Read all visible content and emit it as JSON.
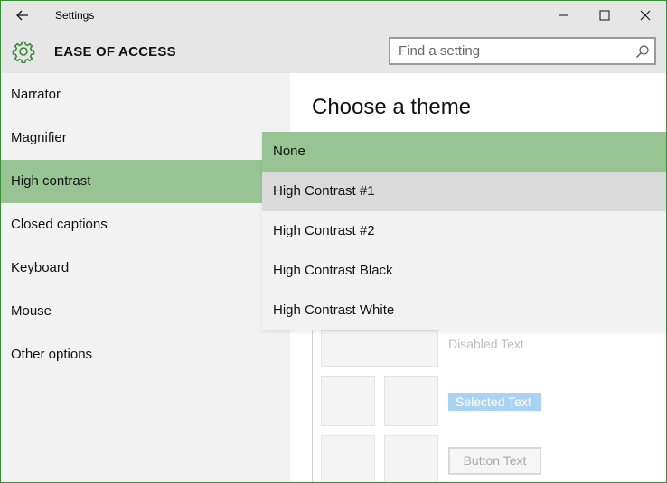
{
  "window": {
    "title": "Settings",
    "accent_color": "#98c494",
    "border_color": "#3a8a3a"
  },
  "header": {
    "section_title": "EASE OF ACCESS",
    "icon": "gear-icon",
    "search": {
      "placeholder": "Find a setting",
      "value": ""
    }
  },
  "sidebar": {
    "items": [
      {
        "label": "Narrator",
        "selected": false
      },
      {
        "label": "Magnifier",
        "selected": false
      },
      {
        "label": "High contrast",
        "selected": true
      },
      {
        "label": "Closed captions",
        "selected": false
      },
      {
        "label": "Keyboard",
        "selected": false
      },
      {
        "label": "Mouse",
        "selected": false
      },
      {
        "label": "Other options",
        "selected": false
      }
    ]
  },
  "main": {
    "heading": "Choose a theme",
    "theme_dropdown": {
      "options": [
        {
          "label": "None",
          "state": "selected"
        },
        {
          "label": "High Contrast #1",
          "state": "hover"
        },
        {
          "label": "High Contrast #2",
          "state": "normal"
        },
        {
          "label": "High Contrast Black",
          "state": "normal"
        },
        {
          "label": "High Contrast White",
          "state": "normal"
        }
      ]
    },
    "preview": {
      "disabled_text": "Disabled Text",
      "selected_text": "Selected Text",
      "button_text": "Button Text"
    }
  }
}
